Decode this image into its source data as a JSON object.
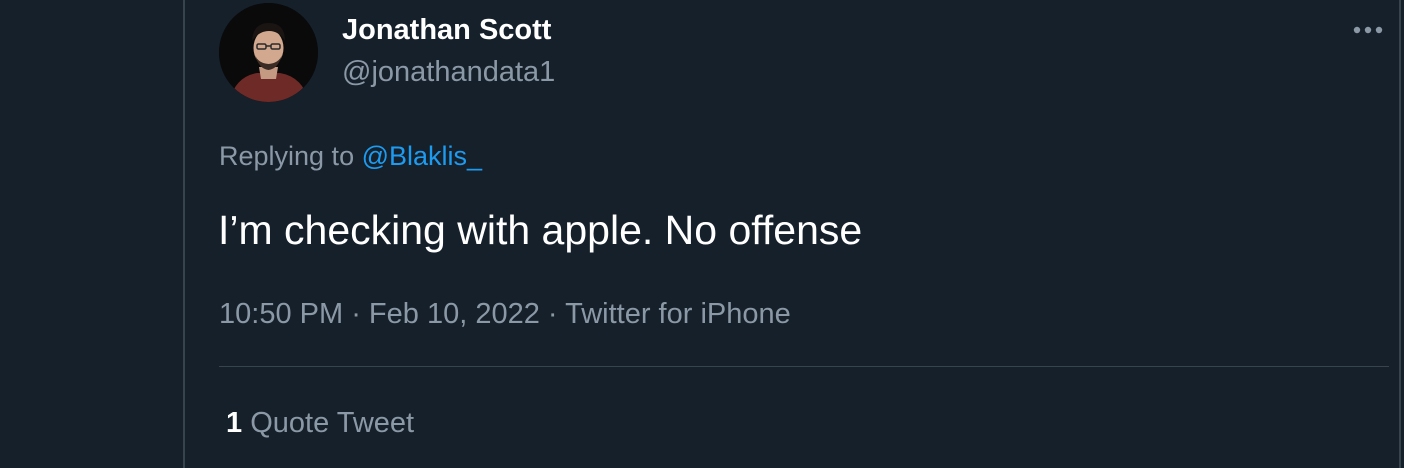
{
  "tweet": {
    "author": {
      "display_name": "Jonathan Scott",
      "handle": "@jonathandata1"
    },
    "replying_prefix": "Replying to ",
    "replying_to": "@Blaklis_",
    "text": "I’m checking with apple. No offense",
    "time": "10:50 PM",
    "separator": " · ",
    "date": "Feb 10, 2022",
    "source": "Twitter for iPhone",
    "stats": {
      "quote_count": "1",
      "quote_label": " Quote Tweet"
    }
  },
  "icons": {
    "more": "more-horizontal-icon"
  },
  "colors": {
    "background": "#15202b",
    "primary_text": "#ffffff",
    "secondary_text": "#8b98a5",
    "link": "#1d9bf0",
    "border": "#38444d"
  }
}
